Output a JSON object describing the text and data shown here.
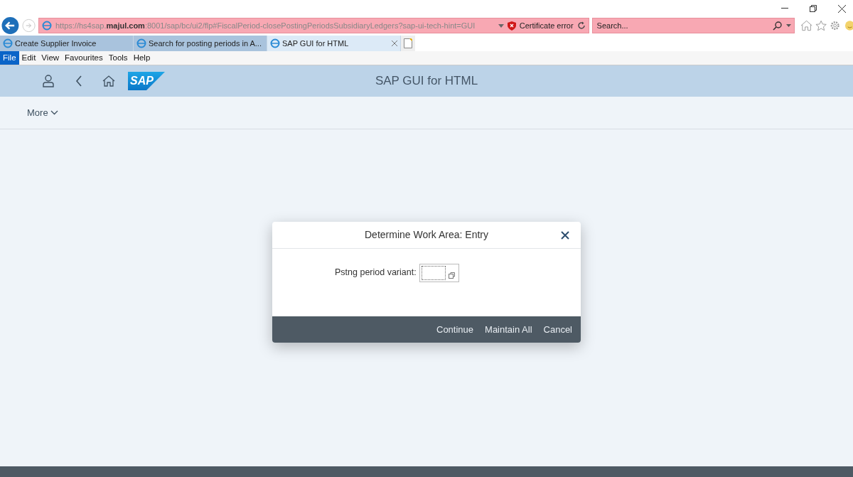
{
  "browser": {
    "address": "https://hs4sap.**majul.com**:8001/sap/bc/ui2/flp#FiscalPeriod-closePostingPeriodsSubsidiaryLedgers?sap-ui-tech-hint=GUI",
    "certificate": "Certificate error",
    "search": {
      "placeholder": "Search..."
    }
  },
  "tabs": [
    {
      "label": "Create Supplier Invoice",
      "selected": false
    },
    {
      "label": "Search for posting periods in A...",
      "selected": false
    },
    {
      "label": "SAP GUI for HTML",
      "selected": true
    }
  ],
  "menu": [
    {
      "label": "File",
      "selected": true
    },
    {
      "label": "Edit",
      "selected": false
    },
    {
      "label": "View",
      "selected": false
    },
    {
      "label": "Favourites",
      "selected": false
    },
    {
      "label": "Tools",
      "selected": false
    },
    {
      "label": "Help",
      "selected": false
    }
  ],
  "shell": {
    "logo": "SAP",
    "title": "SAP GUI for HTML"
  },
  "toolbar": {
    "more": "More"
  },
  "dialog": {
    "title": "Determine Work Area: Entry",
    "field_label": "Pstng period variant:",
    "buttons": [
      "Continue",
      "Maintain All",
      "Cancel"
    ]
  }
}
